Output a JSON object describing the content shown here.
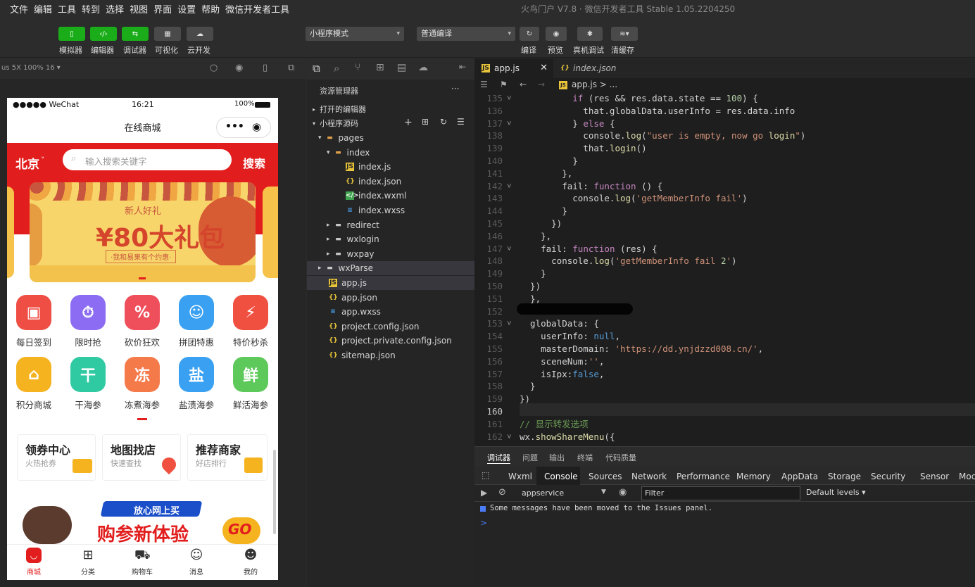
{
  "menubar": {
    "items": [
      "文件",
      "编辑",
      "工具",
      "转到",
      "选择",
      "视图",
      "界面",
      "设置",
      "帮助",
      "微信开发者工具"
    ],
    "window_title": "火鸟门户 V7.8 · 微信开发者工具 Stable 1.05.2204250"
  },
  "toolbar": {
    "left_buttons": [
      {
        "label": "模拟器",
        "icon": "phone-icon"
      },
      {
        "label": "编辑器",
        "icon": "code-icon"
      },
      {
        "label": "调试器",
        "icon": "debug-icon"
      },
      {
        "label": "可视化",
        "icon": "layout-icon"
      },
      {
        "label": "云开发",
        "icon": "cloud-icon"
      }
    ],
    "mode_select": "小程序模式",
    "compile_select": "普通编译",
    "right_buttons": [
      {
        "label": "编译",
        "icon": "refresh-icon"
      },
      {
        "label": "预览",
        "icon": "eye-icon"
      },
      {
        "label": "真机调试",
        "icon": "bug-icon"
      },
      {
        "label": "清缓存",
        "icon": "layers-icon"
      }
    ]
  },
  "simulator": {
    "device_label": "us 5X 100% 16 ▾",
    "status_bar": {
      "carrier": "●●●●● WeChat",
      "time": "16:21",
      "battery": "100%"
    },
    "nav_title": "在线商城",
    "capsule_dots": "•••",
    "city": "北京",
    "search_placeholder": "输入搜索关键字",
    "search_button": "搜索",
    "banner": {
      "tag": "新人好礼",
      "headline": "¥80大礼包",
      "sub": "·我和易果有个约惠·"
    },
    "categories_row1": [
      {
        "label": "每日签到",
        "icon": "calendar-check-icon",
        "color": "#ef4e44"
      },
      {
        "label": "限时抢",
        "icon": "clock-icon",
        "color": "#8b6cf2"
      },
      {
        "label": "砍价狂欢",
        "icon": "bargain-icon",
        "color": "#ef4e5b"
      },
      {
        "label": "拼团特惠",
        "icon": "group-icon",
        "color": "#3aa1f2"
      },
      {
        "label": "特价秒杀",
        "icon": "flash-sale-icon",
        "color": "#f0503f"
      }
    ],
    "categories_row2": [
      {
        "label": "积分商城",
        "icon": "basket-icon",
        "color": "#f5b31f",
        "glyph": ""
      },
      {
        "label": "干海参",
        "icon": "gan-icon",
        "color": "#2fc9a2",
        "glyph": "干"
      },
      {
        "label": "冻煮海参",
        "icon": "dong-icon",
        "color": "#f57a4a",
        "glyph": "冻"
      },
      {
        "label": "盐渍海参",
        "icon": "yan-icon",
        "color": "#3aa1f2",
        "glyph": "盐"
      },
      {
        "label": "鲜活海参",
        "icon": "xian-icon",
        "color": "#5cc95a",
        "glyph": "鲜"
      }
    ],
    "promo_cards": [
      {
        "title": "领券中心",
        "sub": "火热抢券",
        "icon": "coupon-icon"
      },
      {
        "title": "地图找店",
        "sub": "快速查找",
        "icon": "map-pin-icon"
      },
      {
        "title": "推荐商家",
        "sub": "好店排行",
        "icon": "shop-icon"
      }
    ],
    "bottom_banner": {
      "tag": "放心网上买",
      "headline": "购参新体验",
      "go": "GO"
    },
    "tabbar": [
      {
        "label": "商城",
        "icon": "mall-icon",
        "active": true
      },
      {
        "label": "分类",
        "icon": "category-icon",
        "active": false
      },
      {
        "label": "购物车",
        "icon": "cart-icon",
        "active": false
      },
      {
        "label": "消息",
        "icon": "message-icon",
        "active": false
      },
      {
        "label": "我的",
        "icon": "profile-icon",
        "active": false
      }
    ]
  },
  "explorer": {
    "title": "资源管理器",
    "more": "···",
    "open_editors": "打开的编辑器",
    "source_root": "小程序源码",
    "tree": [
      {
        "label": "pages",
        "kind": "folder-open",
        "depth": 1
      },
      {
        "label": "index",
        "kind": "folder-open",
        "depth": 2
      },
      {
        "label": "index.js",
        "kind": "js",
        "depth": 3
      },
      {
        "label": "index.json",
        "kind": "json",
        "depth": 3
      },
      {
        "label": "index.wxml",
        "kind": "wxml",
        "depth": 3
      },
      {
        "label": "index.wxss",
        "kind": "wxss",
        "depth": 3
      },
      {
        "label": "redirect",
        "kind": "folder",
        "depth": 2
      },
      {
        "label": "wxlogin",
        "kind": "folder",
        "depth": 2
      },
      {
        "label": "wxpay",
        "kind": "folder",
        "depth": 2
      },
      {
        "label": "wxParse",
        "kind": "folder",
        "depth": 1
      },
      {
        "label": "app.js",
        "kind": "js",
        "depth": 1
      },
      {
        "label": "app.json",
        "kind": "json",
        "depth": 1
      },
      {
        "label": "app.wxss",
        "kind": "wxss",
        "depth": 1
      },
      {
        "label": "project.config.json",
        "kind": "json",
        "depth": 1
      },
      {
        "label": "project.private.config.json",
        "kind": "json",
        "depth": 1
      },
      {
        "label": "sitemap.json",
        "kind": "json",
        "depth": 1
      }
    ]
  },
  "editor": {
    "tabs": [
      {
        "label": "app.js",
        "icon": "js-file-icon"
      },
      {
        "label": "index.json",
        "icon": "json-file-icon"
      }
    ],
    "breadcrumb": "app.js > ...",
    "code": [
      {
        "n": "135",
        "fold": true,
        "text": "          if (res && res.data.state == 100) {"
      },
      {
        "n": "136",
        "fold": false,
        "text": "            that.globalData.userInfo = res.data.info"
      },
      {
        "n": "137",
        "fold": true,
        "text": "          } else {"
      },
      {
        "n": "138",
        "fold": false,
        "text": "            console.log(\"user is empty, now go login\")"
      },
      {
        "n": "139",
        "fold": false,
        "text": "            that.login()"
      },
      {
        "n": "140",
        "fold": false,
        "text": "          }"
      },
      {
        "n": "141",
        "fold": false,
        "text": "        },"
      },
      {
        "n": "142",
        "fold": true,
        "text": "        fail: function () {"
      },
      {
        "n": "143",
        "fold": false,
        "text": "          console.log('getMemberInfo fail')"
      },
      {
        "n": "144",
        "fold": false,
        "text": "        }"
      },
      {
        "n": "145",
        "fold": false,
        "text": "      })"
      },
      {
        "n": "146",
        "fold": false,
        "text": "    },"
      },
      {
        "n": "147",
        "fold": true,
        "text": "    fail: function (res) {"
      },
      {
        "n": "148",
        "fold": false,
        "text": "      console.log('getMemberInfo fail 2')"
      },
      {
        "n": "149",
        "fold": false,
        "text": "    }"
      },
      {
        "n": "150",
        "fold": false,
        "text": "  })"
      },
      {
        "n": "151",
        "fold": false,
        "text": "  },"
      },
      {
        "n": "152",
        "fold": false,
        "text": ""
      },
      {
        "n": "153",
        "fold": true,
        "text": "  globalData: {"
      },
      {
        "n": "154",
        "fold": false,
        "text": "    userInfo: null,"
      },
      {
        "n": "155",
        "fold": false,
        "text": "    masterDomain: 'https://dd.ynjdzzd008.cn/',"
      },
      {
        "n": "156",
        "fold": false,
        "text": "    sceneNum:'',"
      },
      {
        "n": "157",
        "fold": false,
        "text": "    isIpx:false,"
      },
      {
        "n": "158",
        "fold": false,
        "text": "  }"
      },
      {
        "n": "159",
        "fold": false,
        "text": "})"
      },
      {
        "n": "160",
        "fold": false,
        "text": ""
      },
      {
        "n": "161",
        "fold": false,
        "text": "// 显示转发选项"
      },
      {
        "n": "162",
        "fold": true,
        "text": "wx.showShareMenu({"
      }
    ]
  },
  "console": {
    "top_tabs": [
      "调试器",
      "问题",
      "输出",
      "终端",
      "代码质量"
    ],
    "devtools_tabs": [
      "Wxml",
      "Console",
      "Sources",
      "Network",
      "Performance",
      "Memory",
      "AppData",
      "Storage",
      "Security",
      "Sensor",
      "Moc"
    ],
    "context_select": "appservice",
    "filter_placeholder": "Filter",
    "levels": "Default levels ▾",
    "message": "Some messages have been moved to the Issues panel.",
    "prompt": ">"
  }
}
